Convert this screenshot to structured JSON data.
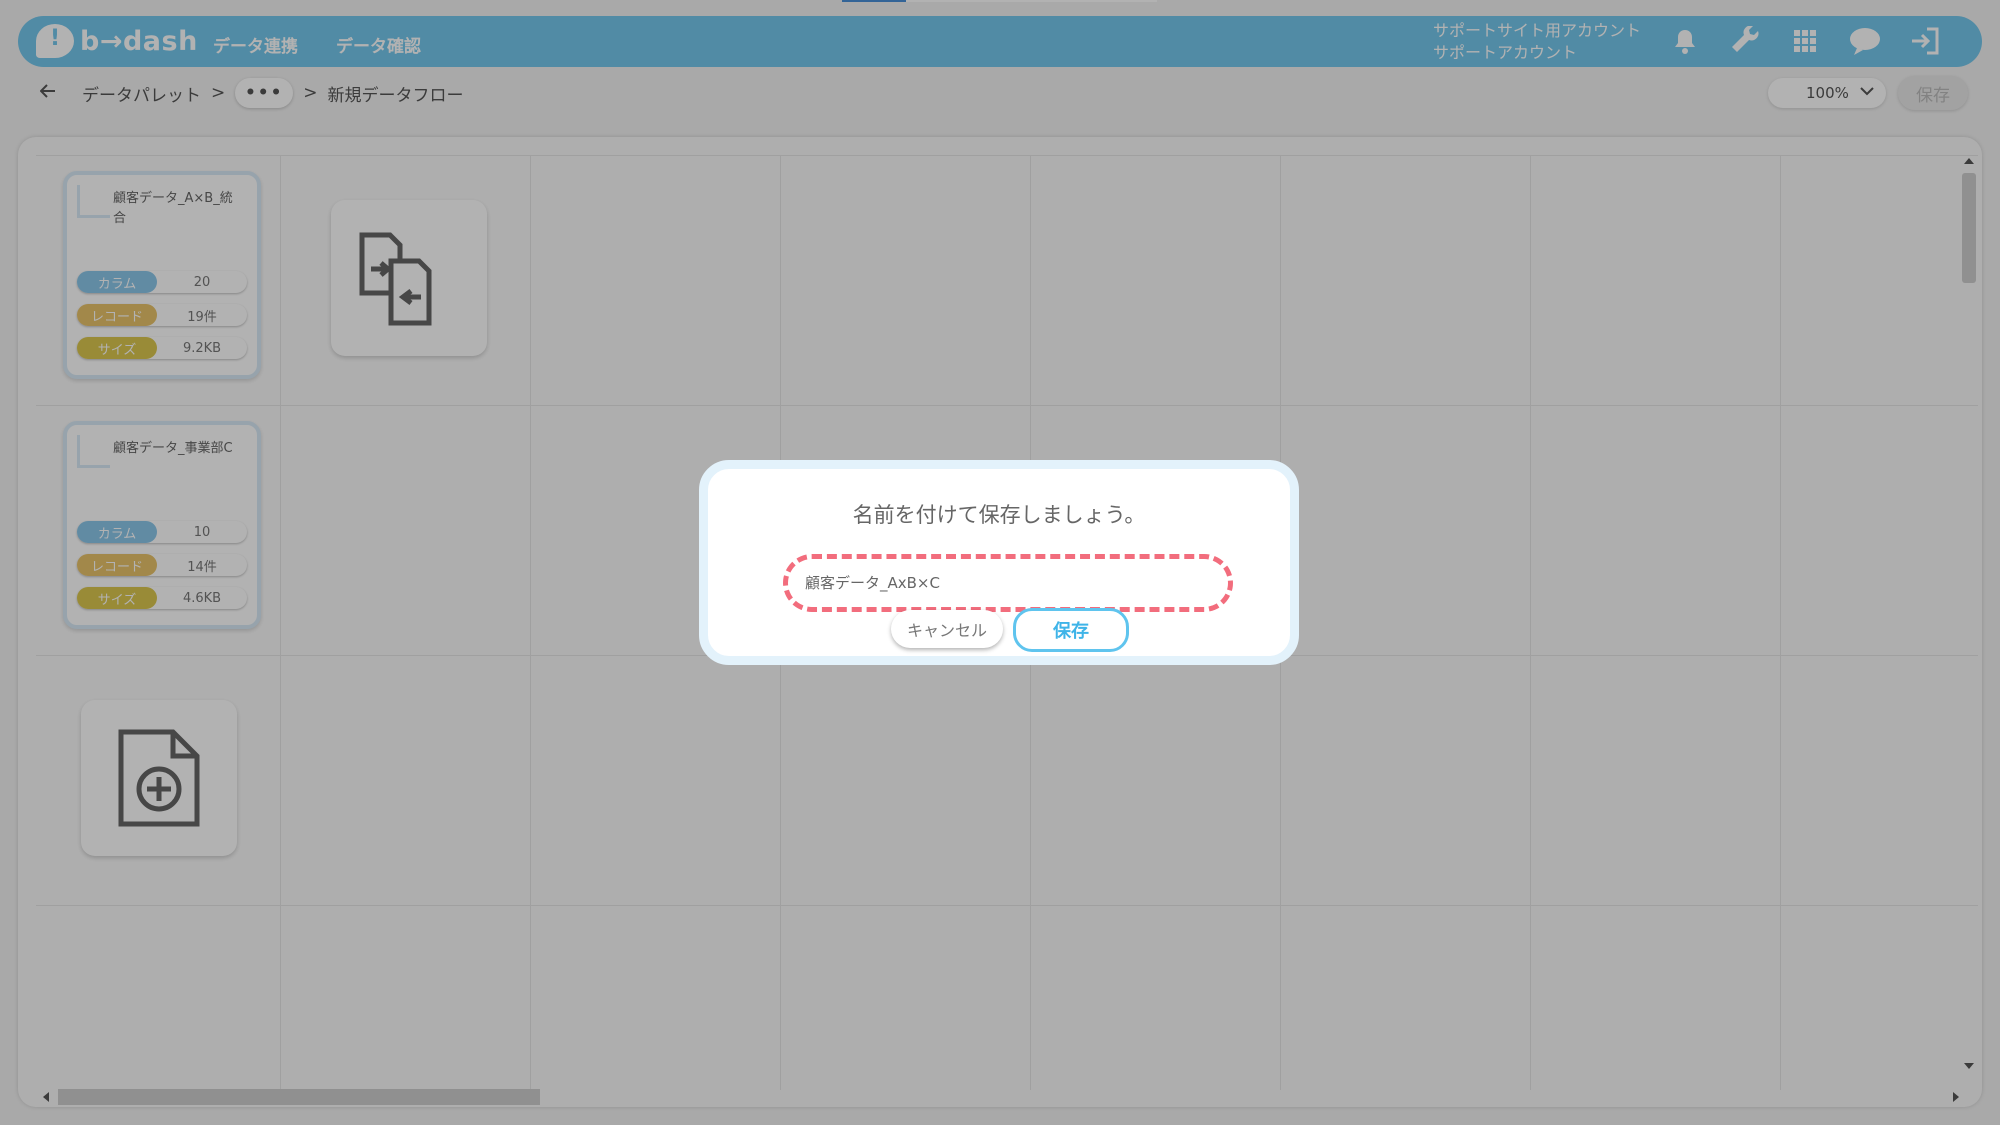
{
  "app": {
    "logo_text": "b→dash"
  },
  "nav": [
    "データ連携",
    "データ確認"
  ],
  "account": {
    "line1": "サポートサイト用アカウント",
    "line2": "サポートアカウント"
  },
  "header_icons": [
    "bell-icon",
    "wrench-icon",
    "grid-icon",
    "chat-icon",
    "logout-icon"
  ],
  "breadcrumb": {
    "parent": "データパレット",
    "sep": ">",
    "ellipsis": "•••",
    "current": "新規データフロー"
  },
  "toolbar": {
    "zoom": "100%",
    "save_label": "保存"
  },
  "cards": [
    {
      "title": "顧客データ_A×B_統合",
      "stats": [
        {
          "label": "カラム",
          "value": "20"
        },
        {
          "label": "レコード",
          "value": "19件"
        },
        {
          "label": "サイズ",
          "value": "9.2KB"
        }
      ]
    },
    {
      "title": "顧客データ_事業部C",
      "stats": [
        {
          "label": "カラム",
          "value": "10"
        },
        {
          "label": "レコード",
          "value": "14件"
        },
        {
          "label": "サイズ",
          "value": "4.6KB"
        }
      ]
    }
  ],
  "colors": {
    "header": "#74c7ec",
    "label_column": "#8cc7ea",
    "label_record": "#e9c36a",
    "label_size": "#dcc84f",
    "highlight": "#f26d7d",
    "save_blue": "#3fb4e8"
  },
  "dialog": {
    "title": "名前を付けて保存しましょう。",
    "input_value": "顧客データ_AxB×C",
    "cancel_label": "キャンセル",
    "save_label": "保存"
  }
}
